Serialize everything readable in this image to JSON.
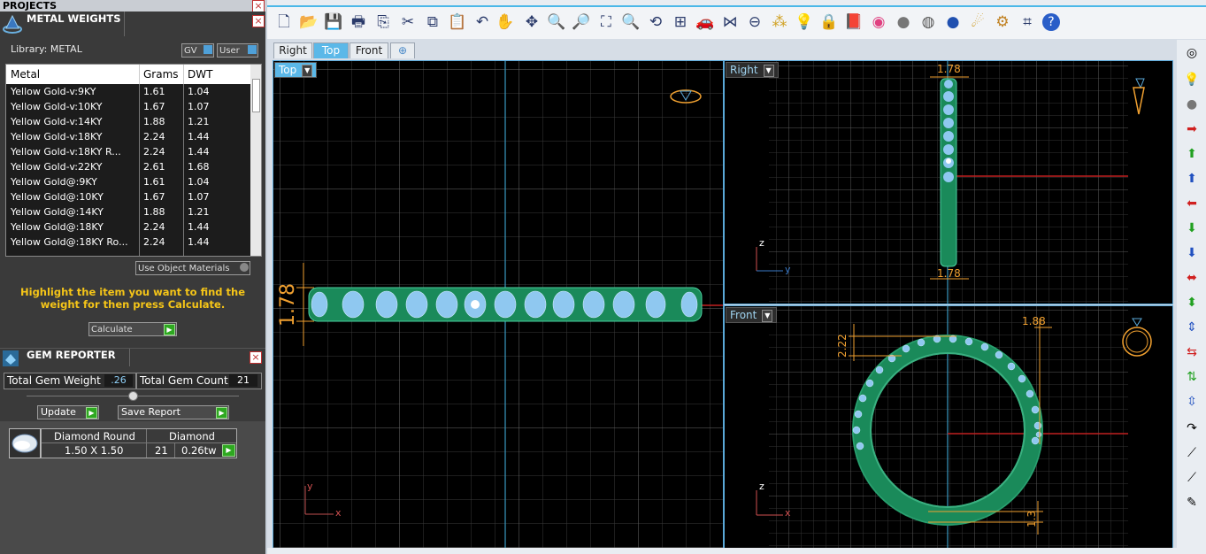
{
  "projects_title": "PROJECTS",
  "metal_weights": {
    "title": "METAL WEIGHTS",
    "library_label": "Library: METAL",
    "gv_label": "GV",
    "user_label": "User",
    "columns": [
      "Metal",
      "Grams",
      "DWT"
    ],
    "rows": [
      {
        "metal": "Yellow Gold-v:9KY",
        "grams": "1.61",
        "dwt": "1.04"
      },
      {
        "metal": "Yellow Gold-v:10KY",
        "grams": "1.67",
        "dwt": "1.07"
      },
      {
        "metal": "Yellow Gold-v:14KY",
        "grams": "1.88",
        "dwt": "1.21"
      },
      {
        "metal": "Yellow Gold-v:18KY",
        "grams": "2.24",
        "dwt": "1.44"
      },
      {
        "metal": "Yellow Gold-v:18KY R...",
        "grams": "2.24",
        "dwt": "1.44"
      },
      {
        "metal": "Yellow Gold-v:22KY",
        "grams": "2.61",
        "dwt": "1.68"
      },
      {
        "metal": "Yellow Gold@:9KY",
        "grams": "1.61",
        "dwt": "1.04"
      },
      {
        "metal": "Yellow Gold@:10KY",
        "grams": "1.67",
        "dwt": "1.07"
      },
      {
        "metal": "Yellow Gold@:14KY",
        "grams": "1.88",
        "dwt": "1.21"
      },
      {
        "metal": "Yellow Gold@:18KY",
        "grams": "2.24",
        "dwt": "1.44"
      },
      {
        "metal": "Yellow Gold@:18KY Ro...",
        "grams": "2.24",
        "dwt": "1.44"
      }
    ],
    "use_object_materials": "Use Object Materials",
    "instruction": "Highlight the item you want to find the weight for then press Calculate.",
    "calculate_label": "Calculate"
  },
  "gem_reporter": {
    "title": "GEM REPORTER",
    "total_weight_label": "Total Gem Weight",
    "total_weight_value": ".26",
    "total_count_label": "Total Gem Count",
    "total_count_value": "21",
    "update_label": "Update",
    "save_report_label": "Save Report",
    "gem_shape_header": "Diamond Round",
    "gem_material_header": "Diamond",
    "gem_size": "1.50 X 1.50",
    "gem_count": "21",
    "gem_total_weight": "0.26tw"
  },
  "view_tabs": [
    "Right",
    "Top",
    "Front"
  ],
  "active_tab": "Top",
  "viewports": {
    "top": {
      "label": "Top",
      "dim": "1.78",
      "axis_v": "y",
      "axis_h": "x"
    },
    "right": {
      "label": "Right",
      "dim_top": "1.78",
      "dim_bottom": "1.78",
      "axis_v": "z",
      "axis_h": "y"
    },
    "front": {
      "label": "Front",
      "dim_width": "1.88",
      "dim_left": "2.22",
      "dim_bottom": "1.3",
      "axis_v": "z",
      "axis_h": "x"
    }
  },
  "colors": {
    "accent": "#4bb8e8",
    "band": "#1a8a5a",
    "grid": "#3a3a3a",
    "dimension": "#f0a030"
  }
}
